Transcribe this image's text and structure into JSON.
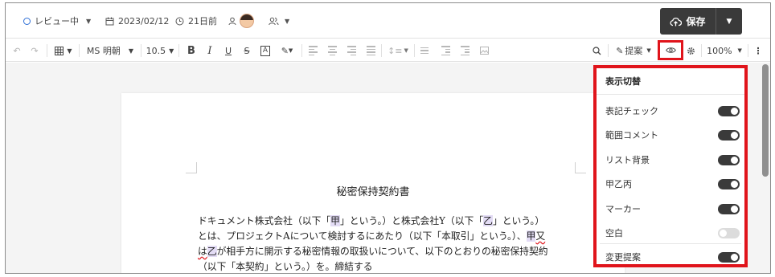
{
  "header": {
    "status_label": "レビュー中",
    "date": "2023/02/12",
    "elapsed": "21日前",
    "save_label": "保存"
  },
  "toolbar": {
    "font_name": "MS 明朝",
    "font_size": "10.5",
    "suggest_label": "提案",
    "zoom": "100%",
    "bold": "B",
    "italic": "I",
    "underline": "U",
    "strike": "S",
    "boxed": "A"
  },
  "document": {
    "title": "秘密保持契約書",
    "lines": [
      [
        "ドキュメント株式会社（以下「",
        "甲",
        "」という。）と株式会社Y（以下「",
        "乙",
        "」という。）"
      ],
      [
        "とは、プロジェクトAについて検討するにあたり（以下「本取引」という。）、",
        "甲",
        "又"
      ],
      [
        "は",
        "乙",
        "が相手方に開示する秘密情報の取扱いについて、以下のとおりの秘密保持契約"
      ],
      [
        "（以下「本契約」という。）を。締結する"
      ]
    ]
  },
  "display_panel": {
    "title": "表示切替",
    "items": [
      {
        "label": "表記チェック",
        "on": true
      },
      {
        "label": "範囲コメント",
        "on": true
      },
      {
        "label": "リスト背景",
        "on": true
      },
      {
        "label": "甲乙丙",
        "on": true
      },
      {
        "label": "マーカー",
        "on": true
      },
      {
        "label": "空白",
        "on": false
      },
      {
        "label": "変更提案",
        "on": true
      }
    ]
  },
  "colors": {
    "accent_red": "#e0141b",
    "save_bg": "#3a3a3a",
    "highlight": "#e3dcf5",
    "status_blue": "#2f6fd6"
  }
}
